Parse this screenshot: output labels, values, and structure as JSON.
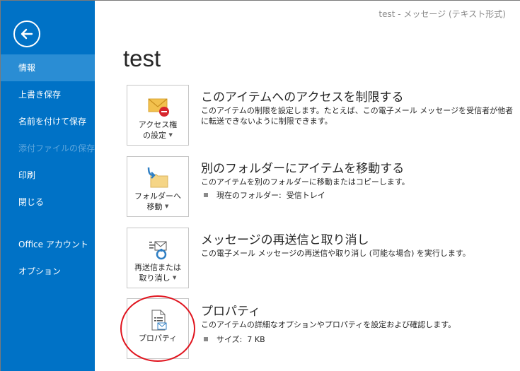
{
  "window_title": "test - メッセージ (テキスト形式)",
  "sidebar": {
    "back_icon": "back-arrow-icon",
    "items": [
      {
        "label": "情報",
        "active": true
      },
      {
        "label": "上書き保存"
      },
      {
        "label": "名前を付けて保存"
      },
      {
        "label": "添付ファイルの保存",
        "disabled": true
      },
      {
        "label": "印刷"
      },
      {
        "label": "閉じる"
      },
      {
        "label": "Office アカウント"
      },
      {
        "label": "オプション"
      }
    ]
  },
  "main": {
    "page_title": "test",
    "sections": [
      {
        "tile_label_line1": "アクセス権",
        "tile_label_line2": "の設定",
        "title": "このアイテムへのアクセスを制限する",
        "desc": "このアイテムの制限を設定します。たとえば、この電子メール メッセージを受信者が他者に転送できないように制限できます。"
      },
      {
        "tile_label_line1": "フォルダーへ",
        "tile_label_line2": "移動",
        "title": "別のフォルダーにアイテムを移動する",
        "desc": "このアイテムを別のフォルダーに移動またはコピーします。",
        "bullet_label": "現在のフォルダー:",
        "bullet_value": "受信トレイ"
      },
      {
        "tile_label_line1": "再送信または",
        "tile_label_line2": "取り消し",
        "title": "メッセージの再送信と取り消し",
        "desc": "この電子メール メッセージの再送信や取り消し (可能な場合) を実行します。"
      },
      {
        "tile_label_line1": "プロパティ",
        "title": "プロパティ",
        "desc": "このアイテムの詳細なオプションやプロパティを設定および確認します。",
        "bullet_label": "サイズ:",
        "bullet_value": "7 KB"
      }
    ]
  },
  "colors": {
    "sidebar": "#0072c6",
    "sidebar_active": "#2a8dd4",
    "highlight_circle": "#e0141e"
  }
}
